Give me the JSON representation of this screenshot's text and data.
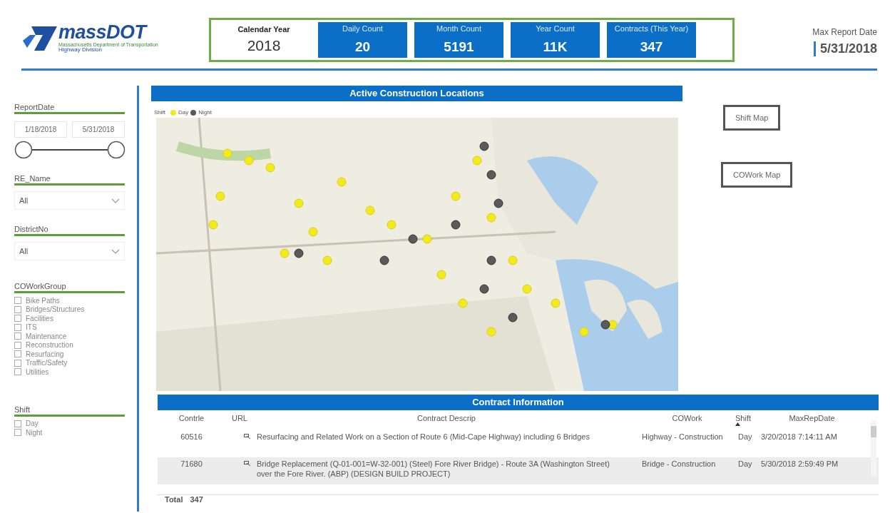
{
  "logo": {
    "name": "massDOT",
    "subtitle": "Massachusetts Department of Transportation",
    "division": "Highway Division"
  },
  "calendar_year": {
    "label": "Calendar Year",
    "value": "2018"
  },
  "kpis": [
    {
      "label": "Daily Count",
      "value": "20"
    },
    {
      "label": "Month Count",
      "value": "5191"
    },
    {
      "label": "Year Count",
      "value": "11K"
    },
    {
      "label": "Contracts (This Year)",
      "value": "347"
    }
  ],
  "max_report_date": {
    "label": "Max Report Date",
    "value": "5/31/2018"
  },
  "report_date": {
    "title": "ReportDate",
    "start": "1/18/2018",
    "end": "5/31/2018",
    "handles": [
      {
        "level": 0
      },
      {
        "level": 1
      }
    ]
  },
  "dropdowns": [
    {
      "title": "RE_Name",
      "value": "All"
    },
    {
      "title": "DistrictNo",
      "value": "All"
    }
  ],
  "checklists": [
    {
      "title": "COWorkGroup",
      "options": [
        {
          "label": "Bike Paths",
          "checked": false
        },
        {
          "label": "Bridges/Structures",
          "checked": false
        },
        {
          "label": "Facilities",
          "checked": false
        },
        {
          "label": "ITS",
          "checked": false
        },
        {
          "label": "Maintenance",
          "checked": false
        },
        {
          "label": "Reconstruction",
          "checked": false
        },
        {
          "label": "Resurfacing",
          "checked": false
        },
        {
          "label": "Traffic/Safety",
          "checked": false
        },
        {
          "label": "Utilities",
          "checked": false
        }
      ]
    },
    {
      "title": "Shift",
      "options": [
        {
          "label": "Day",
          "checked": false
        },
        {
          "label": "Night",
          "checked": false
        }
      ]
    }
  ],
  "map": {
    "title": "Active Construction Locations",
    "legend": {
      "label": "Shift",
      "items": [
        {
          "label": "Day",
          "color": "#f2ea1c"
        },
        {
          "label": "Night",
          "color": "#5a5a5a"
        }
      ]
    }
  },
  "buttons": [
    "Shift Map",
    "COWork Map"
  ],
  "table": {
    "title": "Contract Information",
    "columns": [
      {
        "label": "Contrle",
        "sorted": false
      },
      {
        "label": "URL",
        "sorted": false
      },
      {
        "label": "Contract Descrip",
        "sorted": false
      },
      {
        "label": "COWork",
        "sorted": false
      },
      {
        "label": "Shift",
        "sorted": true
      },
      {
        "label": "MaxRepDate",
        "sorted": false
      }
    ],
    "rows": [
      {
        "contract": "60516",
        "description": "Resurfacing and Related Work on a Section of Route 6 (Mid-Cape Highway) including 6 Bridges",
        "cowork": "Highway - Construction",
        "shift": "Day",
        "date": "3/20/2018 7:14:11 AM"
      },
      {
        "contract": "71680",
        "description": "Bridge Replacement (Q-01-001=W-32-001) (Steel) Fore River Bridge) - Route 3A (Washington Street) over the Fore River. (ABP) (DESIGN BUILD PROJECT)",
        "cowork": "Bridge - Construction",
        "shift": "Day",
        "date": "5/30/2018 2:59:49 PM"
      }
    ],
    "total": {
      "label": "Total",
      "value": "347"
    }
  }
}
